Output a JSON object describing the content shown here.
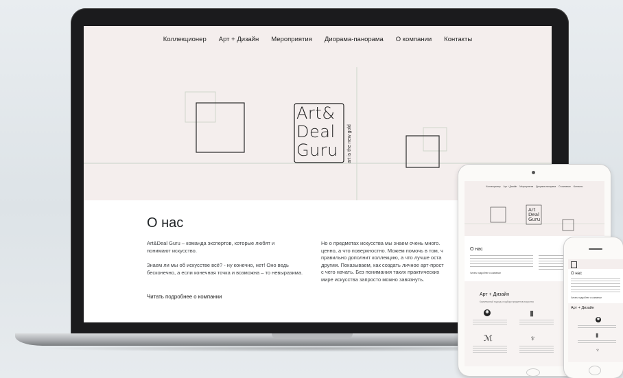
{
  "nav": {
    "items": [
      "Коллекционер",
      "Арт + Дизайн",
      "Мероприятия",
      "Диорама-панорама",
      "О компании",
      "Контакты"
    ]
  },
  "logo": {
    "lines": [
      "Art&",
      "Deal",
      "Guru"
    ],
    "tagline": "art is the new gold"
  },
  "about": {
    "title": "О нас",
    "left_p1": "Art&Deal Guru – команда экспертов, которые любят и понимают искусство.",
    "left_p2": "Знаем ли мы об искусстве всё? - ну конечно, нет! Оно ведь бесконечно, а если конечная точка и возможна – то невыразима.",
    "read_more": "Читать подробнее о компании",
    "right_p_lines": [
      "Но о предметах искусства мы знаем очень много.",
      "ценно, а что поверхностно. Можем помочь в том, ч",
      "правильно дополнит коллекцию, а что лучше оста",
      "другим. Показываем, как создать личное арт-прост",
      "с чего начать. Без понимания таких практических",
      "мире искусства запросто можно завязнуть."
    ]
  },
  "tablet": {
    "nav": [
      "Коллекционер",
      "Арт + Дизайн",
      "Мероприятия",
      "Диорама-панорама",
      "О компании",
      "Контакты"
    ],
    "about_title": "О нас",
    "read_more": "Читать подробнее о компании",
    "art_title": "Арт + Дизайн",
    "art_sub": "Комплексный подход к подбору предметов искусства"
  },
  "phone": {
    "about_title": "О нас",
    "read_more": "Читать подробнее о компании",
    "art_title": "Арт + Дизайн"
  },
  "colors": {
    "hero_bg": "#f4eeed",
    "accent_line": "#c7d2c6",
    "text_dark": "#1f2326"
  },
  "icons": [
    "sparkle-icon",
    "building-icon",
    "easel-icon",
    "lamp-icon"
  ]
}
